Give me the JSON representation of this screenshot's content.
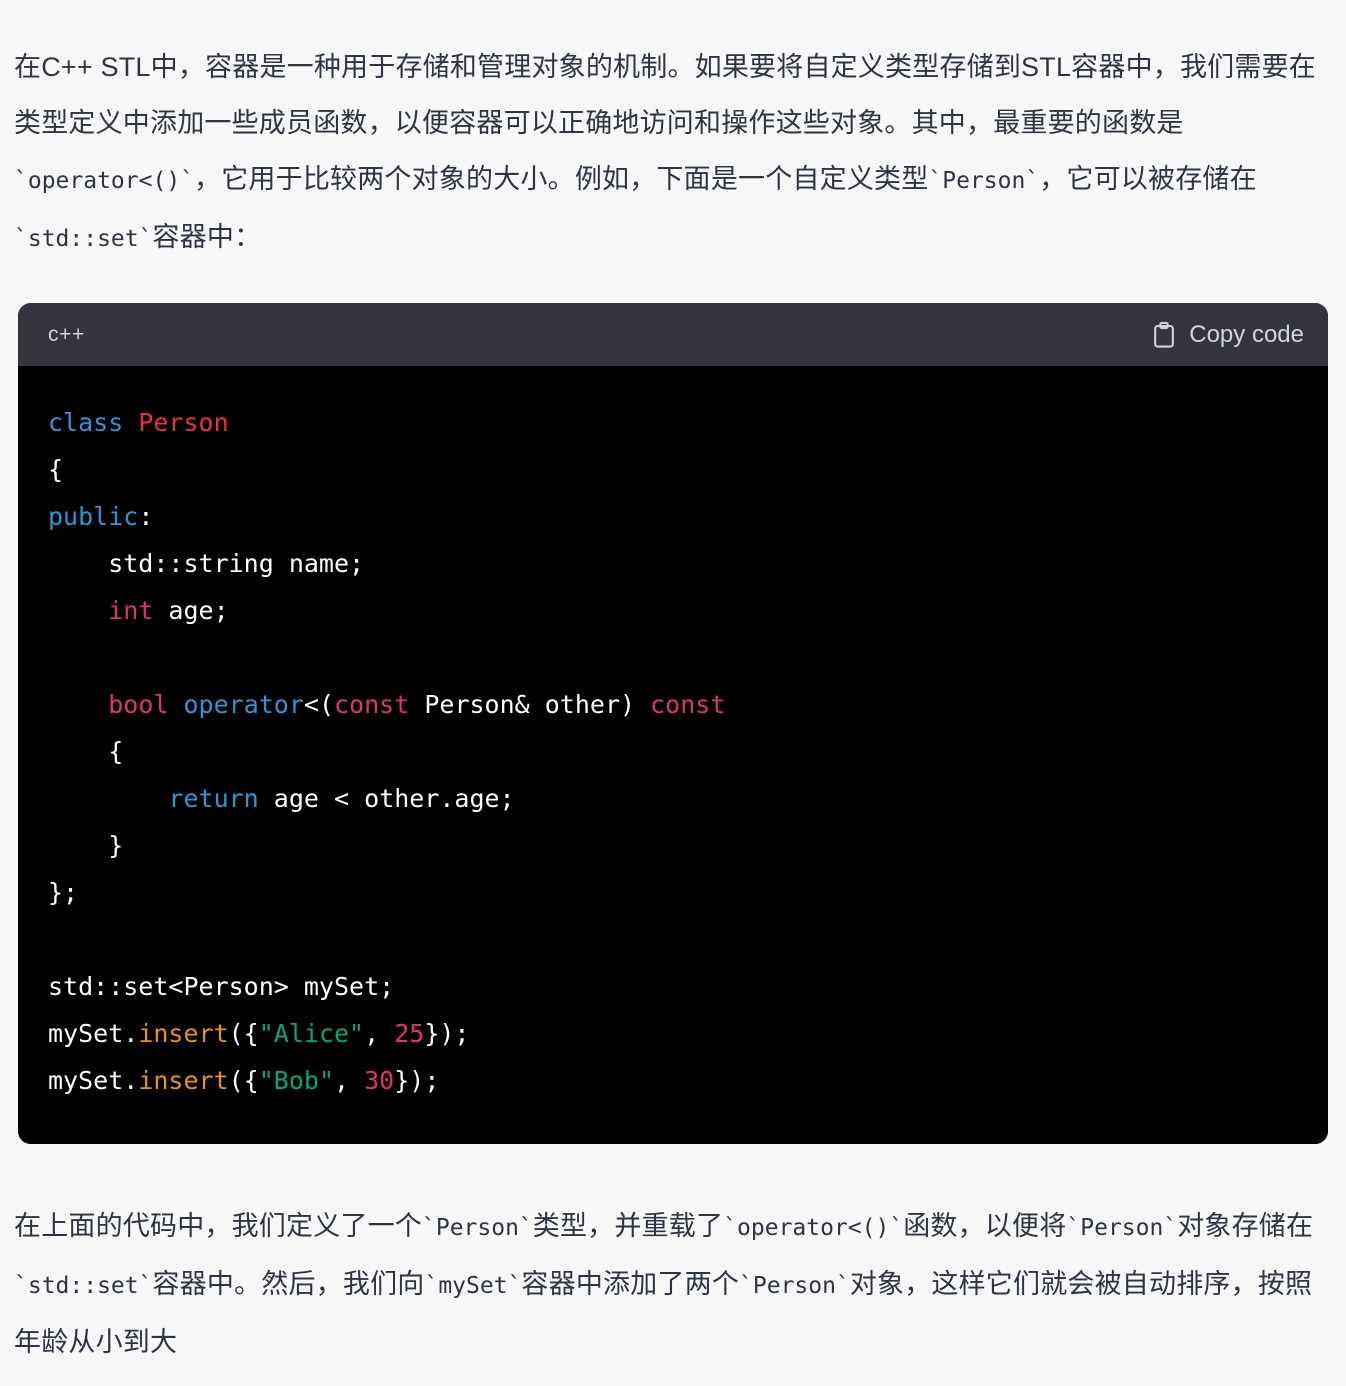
{
  "page": {
    "background_color": "#f7f7f8",
    "text_color": "#2d3442"
  },
  "intro_paragraph": "在C++ STL中，容器是一种用于存储和管理对象的机制。如果要将自定义类型存储到STL容器中，我们需要在类型定义中添加一些成员函数，以便容器可以正确地访问和操作这些对象。其中，最重要的函数是`operator<()`，它用于比较两个对象的大小。例如，下面是一个自定义类型`Person`，它可以被存储在`std::set`容器中：",
  "outro_paragraph": "在上面的代码中，我们定义了一个`Person`类型，并重载了`operator<()`函数，以便将`Person`对象存储在`std::set`容器中。然后，我们向`mySet`容器中添加了两个`Person`对象，这样它们就会被自动排序，按照年龄从小到大",
  "code_block": {
    "language_label": "c++",
    "copy_label": "Copy code",
    "copy_icon": "clipboard-icon",
    "header_background": "#343541",
    "body_background": "#000000",
    "code_text": "class Person\n{\npublic:\n    std::string name;\n    int age;\n\n    bool operator<(const Person& other) const\n    {\n        return age < other.age;\n    }\n};\n\nstd::set<Person> mySet;\nmySet.insert({\"Alice\", 25});\nmySet.insert({\"Bob\", 30});",
    "tokens": {
      "keyword_color": "#2e95d3",
      "type_color": "#df3079",
      "class_color": "#f22c3d",
      "function_color": "#e9950c",
      "string_color": "#00a67d",
      "number_color": "#df3079",
      "plain_color": "#ffffff"
    },
    "lines": [
      "class Person",
      "{",
      "public:",
      "    std::string name;",
      "    int age;",
      "",
      "    bool operator<(const Person& other) const",
      "    {",
      "        return age < other.age;",
      "    }",
      "};",
      "",
      "std::set<Person> mySet;",
      "mySet.insert({\"Alice\", 25});",
      "mySet.insert({\"Bob\", 30});"
    ]
  }
}
